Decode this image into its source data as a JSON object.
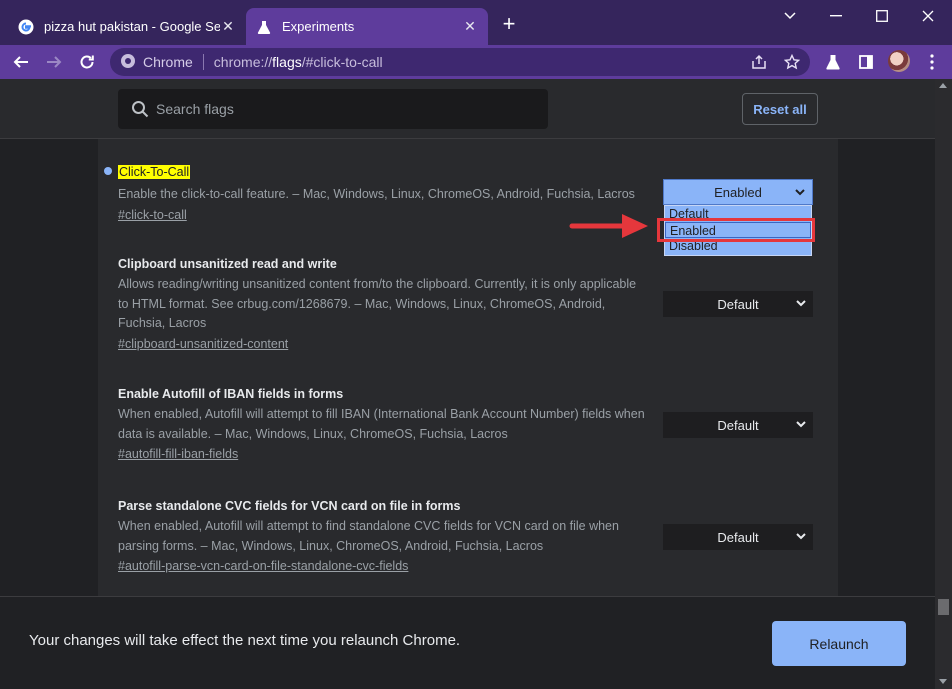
{
  "tabs": [
    {
      "title": "pizza hut pakistan - Google Searc",
      "icon": "google-icon",
      "active": false
    },
    {
      "title": "Experiments",
      "icon": "flask-icon",
      "active": true
    }
  ],
  "omnibox": {
    "chip": "Chrome",
    "url_scheme": "chrome://",
    "url_host": "flags",
    "url_path": "/#click-to-call"
  },
  "search": {
    "placeholder": "Search flags"
  },
  "reset_label": "Reset all",
  "flags": [
    {
      "title": "Click-To-Call",
      "description": "Enable the click-to-call feature. – Mac, Windows, Linux, ChromeOS, Android, Fuchsia, Lacros",
      "link": "#click-to-call",
      "value": "Enabled"
    },
    {
      "title": "Clipboard unsanitized read and write",
      "description": "Allows reading/writing unsanitized content from/to the clipboard. Currently, it is only applicable to HTML format. See crbug.com/1268679. – Mac, Windows, Linux, ChromeOS, Android, Fuchsia, Lacros",
      "link": "#clipboard-unsanitized-content",
      "value": "Default"
    },
    {
      "title": "Enable Autofill of IBAN fields in forms",
      "description": "When enabled, Autofill will attempt to fill IBAN (International Bank Account Number) fields when data is available. – Mac, Windows, Linux, ChromeOS, Fuchsia, Lacros",
      "link": "#autofill-fill-iban-fields",
      "value": "Default"
    },
    {
      "title": "Parse standalone CVC fields for VCN card on file in forms",
      "description": "When enabled, Autofill will attempt to find standalone CVC fields for VCN card on file when parsing forms. – Mac, Windows, Linux, ChromeOS, Android, Fuchsia, Lacros",
      "link": "#autofill-parse-vcn-card-on-file-standalone-cvc-fields",
      "value": "Default"
    }
  ],
  "dropdown_options": [
    "Default",
    "Enabled",
    "Disabled"
  ],
  "bottom": {
    "message": "Your changes will take effect the next time you relaunch Chrome.",
    "relaunch_label": "Relaunch"
  },
  "colors": {
    "frame": "#35255c",
    "toolbar": "#5e3c9c",
    "accent": "#8ab4f8",
    "highlight": "#ffff00",
    "annotation_red": "#e5373c"
  }
}
